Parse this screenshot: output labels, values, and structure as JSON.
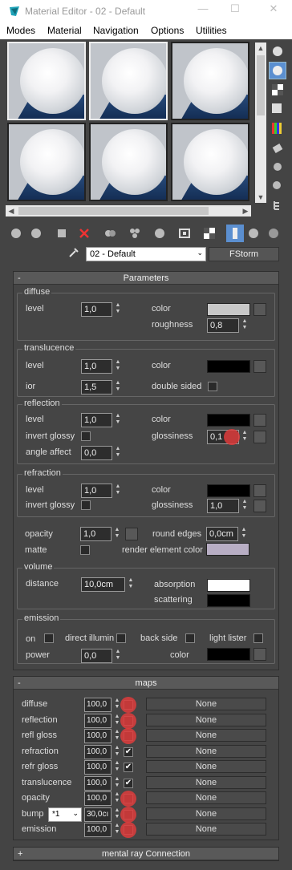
{
  "window": {
    "title": "Material Editor - 02 - Default"
  },
  "menu": [
    "Modes",
    "Material",
    "Navigation",
    "Options",
    "Utilities"
  ],
  "material": {
    "name": "02 - Default",
    "type_button": "FStorm"
  },
  "parameters": {
    "header": "Parameters",
    "diffuse": {
      "title": "diffuse",
      "level_label": "level",
      "level": "1,0",
      "color_label": "color",
      "color": "#c8c8c8",
      "roughness_label": "roughness",
      "roughness": "0,8"
    },
    "translucence": {
      "title": "translucence",
      "level_label": "level",
      "level": "1,0",
      "color_label": "color",
      "color": "#000000",
      "ior_label": "ior",
      "ior": "1,5",
      "double_sided_label": "double sided"
    },
    "reflection": {
      "title": "reflection",
      "level_label": "level",
      "level": "1,0",
      "color_label": "color",
      "color": "#000000",
      "invert_glossy_label": "invert glossy",
      "glossiness_label": "glossiness",
      "glossiness": "0,1",
      "angle_affect_label": "angle affect",
      "angle_affect": "0,0"
    },
    "refraction": {
      "title": "refraction",
      "level_label": "level",
      "level": "1,0",
      "color_label": "color",
      "color": "#000000",
      "invert_glossy_label": "invert glossy",
      "glossiness_label": "glossiness",
      "glossiness": "1,0"
    },
    "opacity_label": "opacity",
    "opacity": "1,0",
    "round_edges_label": "round edges",
    "round_edges": "0,0cm",
    "matte_label": "matte",
    "render_element_color_label": "render element color",
    "render_element_color": "#b8aec4",
    "volume": {
      "title": "volume",
      "distance_label": "distance",
      "distance": "10,0cm",
      "absorption_label": "absorption",
      "absorption": "#ffffff",
      "scattering_label": "scattering",
      "scattering": "#000000"
    },
    "emission": {
      "title": "emission",
      "on_label": "on",
      "direct_illumin_label": "direct illumin",
      "back_side_label": "back side",
      "light_lister_label": "light lister",
      "power_label": "power",
      "power": "0,0",
      "color_label": "color",
      "color": "#000000"
    }
  },
  "maps": {
    "header": "maps",
    "rows": [
      {
        "label": "diffuse",
        "value": "100,0",
        "checked": false,
        "map": "None"
      },
      {
        "label": "reflection",
        "value": "100,0",
        "checked": false,
        "map": "None"
      },
      {
        "label": "refl gloss",
        "value": "100,0",
        "checked": false,
        "map": "None"
      },
      {
        "label": "refraction",
        "value": "100,0",
        "checked": true,
        "map": "None"
      },
      {
        "label": "refr gloss",
        "value": "100,0",
        "checked": true,
        "map": "None"
      },
      {
        "label": "translucence",
        "value": "100,0",
        "checked": true,
        "map": "None"
      },
      {
        "label": "opacity",
        "value": "100,0",
        "checked": false,
        "map": "None"
      },
      {
        "label": "bump",
        "value": "30,0cı",
        "checked": false,
        "map": "None",
        "mult": "*1"
      },
      {
        "label": "emission",
        "value": "100,0",
        "checked": false,
        "map": "None"
      }
    ]
  },
  "mental_ray": {
    "header": "mental ray Connection"
  }
}
